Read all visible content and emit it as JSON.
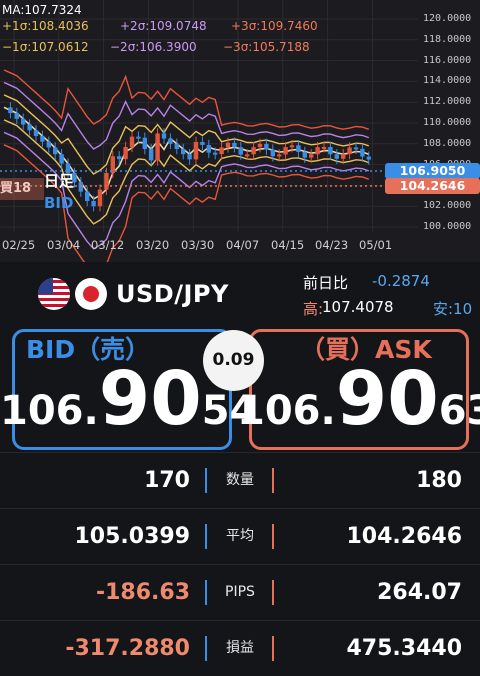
{
  "chart": {
    "legend": {
      "ma": "MA:107.7324",
      "p1": "+1σ:108.4036",
      "p2": "+2σ:109.0748",
      "p3": "+3σ:109.7460",
      "m1": "−1σ:107.0612",
      "m2": "−2σ:106.3900",
      "m3": "−3σ:105.7188"
    },
    "y_ticks": [
      "120.0000",
      "118.0000",
      "116.0000",
      "114.0000",
      "112.0000",
      "110.0000",
      "108.0000",
      "106.0000",
      "104.0000",
      "102.0000",
      "100.0000"
    ],
    "x_ticks": [
      "02/25",
      "03/04",
      "03/12",
      "03/20",
      "03/30",
      "04/07",
      "04/15",
      "04/23",
      "05/01"
    ],
    "bid_tag": "106.9050",
    "ask_tag": "104.2646",
    "position_label": "買18",
    "timeframe": "日足",
    "side_label": "BID",
    "colors": {
      "up": "#e0573d",
      "down": "#3a8ee6",
      "ma": "#e9d8a6",
      "sigma1": "#e8c15a",
      "sigma2": "#b882e6",
      "sigma3": "#e8553b"
    }
  },
  "pair": {
    "name": "USD/JPY",
    "prev_label": "前日比",
    "prev_value": "-0.2874",
    "high_label": "高:",
    "high_value": "107.4078",
    "low_label": "安:10"
  },
  "bid": {
    "title": "BID（売）",
    "int": "106.",
    "big": "90",
    "small": "54"
  },
  "ask": {
    "title": "（買）ASK",
    "int": "106.",
    "big": "90",
    "small": "63"
  },
  "spread": "0.09",
  "rows": [
    {
      "left": "170",
      "label": "数量",
      "right": "180",
      "left_color": "#ffffff"
    },
    {
      "left": "105.0399",
      "label": "平均",
      "right": "104.2646",
      "left_color": "#ffffff"
    },
    {
      "left": "-186.63",
      "label": "PIPS",
      "right": "264.07",
      "left_color": "#f08a6e"
    },
    {
      "left": "-317.2880",
      "label": "損益",
      "right": "475.3440",
      "left_color": "#f08a6e"
    }
  ]
}
